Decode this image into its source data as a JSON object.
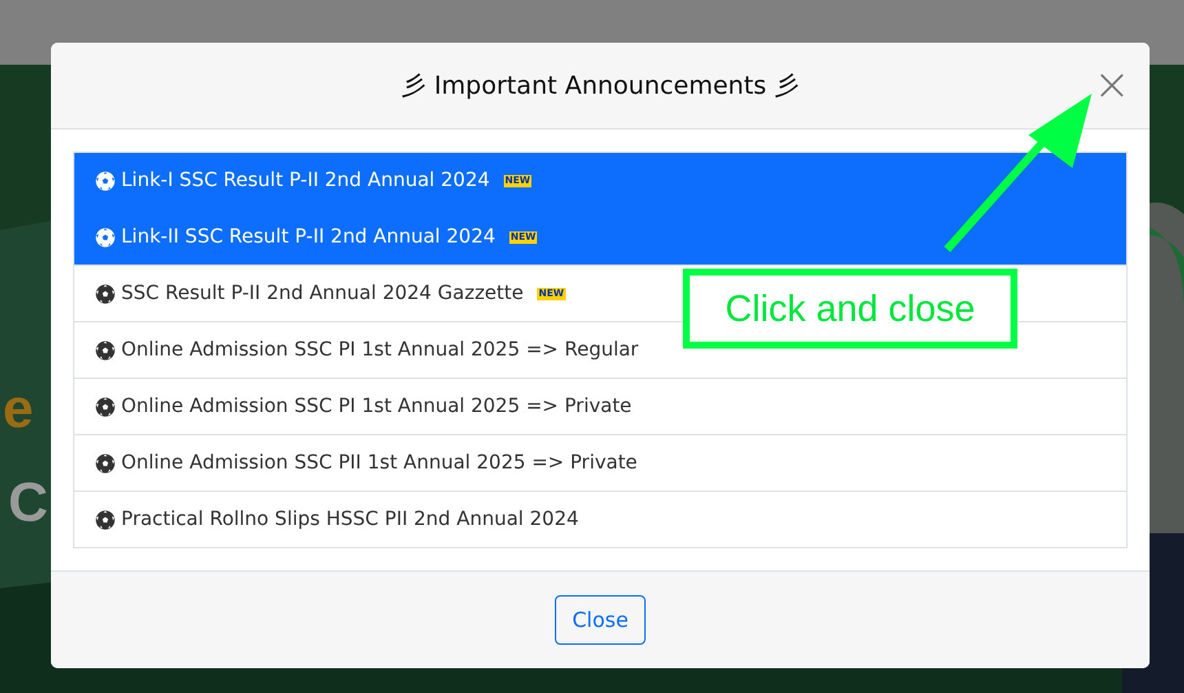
{
  "backdrop": {
    "hero_fragments": [
      {
        "text": "e",
        "kind": "heading"
      },
      {
        "text": "C",
        "kind": "subheading"
      }
    ]
  },
  "modal": {
    "title_mark_left": "彡",
    "title": "Important Announcements",
    "title_mark_right": "彡",
    "close_icon": "×",
    "items": [
      {
        "text": "Link-I SSC Result P-II 2nd Annual 2024",
        "badge": "NEW",
        "selected": true
      },
      {
        "text": "Link-II SSC Result P-II 2nd Annual 2024",
        "badge": "NEW",
        "selected": true
      },
      {
        "text": "SSC Result P-II 2nd Annual 2024 Gazzette",
        "badge": "NEW",
        "selected": false
      },
      {
        "text": "Online Admission SSC PI 1st Annual 2025 => Regular",
        "selected": false
      },
      {
        "text": "Online Admission SSC PI 1st Annual 2025 => Private",
        "selected": false
      },
      {
        "text": "Online Admission SSC PII 1st Annual 2025 => Private",
        "selected": false
      },
      {
        "text": "Practical Rollno Slips HSSC PII 2nd Annual 2024",
        "selected": false
      }
    ],
    "footer_button": "Close"
  },
  "annotation": {
    "text": "Click and close"
  }
}
